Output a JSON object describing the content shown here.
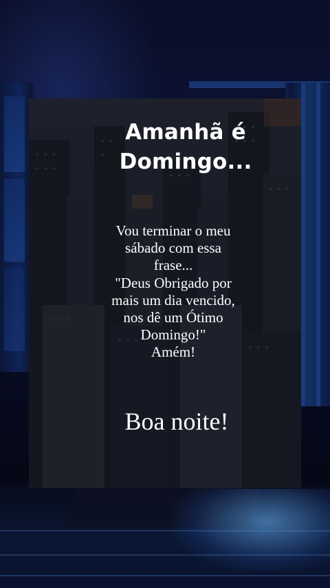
{
  "card": {
    "title_lines": [
      "Amanhã é",
      "Domingo..."
    ],
    "message_lines": [
      "Vou terminar o meu",
      "sábado com essa",
      "frase...",
      "\"Deus Obrigado por",
      "mais um dia vencido,",
      "nos dê um Ótimo",
      "Domingo!\"",
      "Amém!"
    ],
    "closing": "Boa noite!"
  },
  "colors": {
    "text": "#ffffff",
    "background_night_blue": "#0c1434",
    "floor_glow": "#6ebeff"
  }
}
